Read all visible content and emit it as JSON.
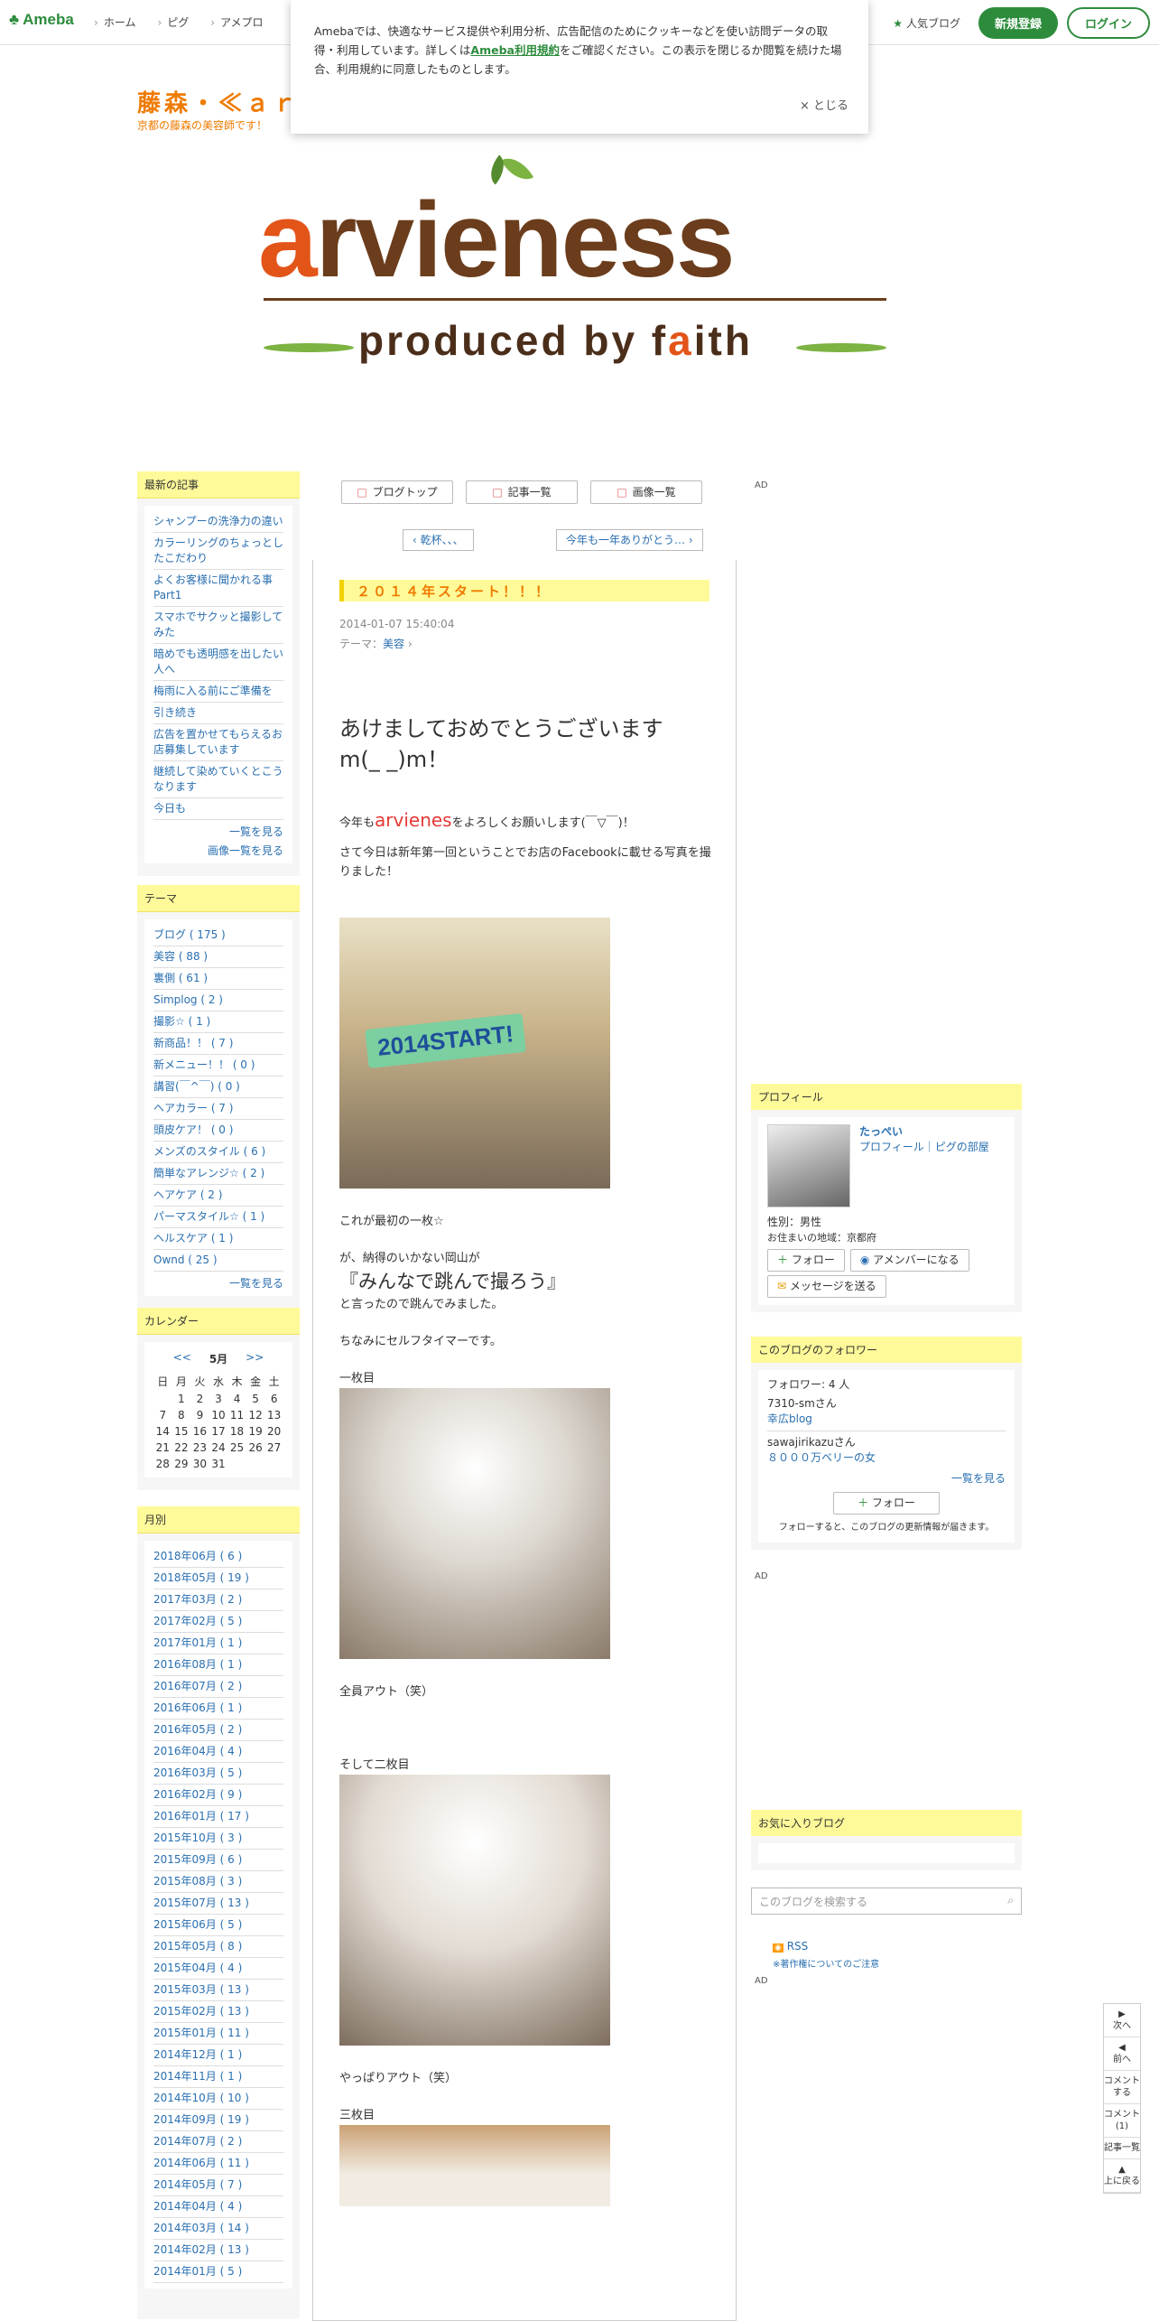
{
  "header": {
    "logo": "Ameba",
    "nav": [
      "ホーム",
      "ピグ",
      "アメプロ"
    ],
    "popular": "人気ブログ",
    "register": "新規登録",
    "login": "ログイン"
  },
  "cookie": {
    "text_before": "Amebaでは、快適なサービス提供や利用分析、広告配信のためにクッキーなどを使い訪問データの取得・利用しています。詳しくは",
    "link": "Ameba利用規約",
    "text_after": "をご確認ください。この表示を閉じるか閲覧を続けた場合、利用規約に同意したものとします。",
    "close": "× とじる"
  },
  "blog": {
    "title": "藤森・≪ａｒｖ",
    "subtitle": "京都の藤森の美容師です！"
  },
  "banner": {
    "word_orange": "a",
    "word_brown": "rvieness",
    "tag1": "produced by f",
    "tag2": "a",
    "tag3": "ith"
  },
  "recent": {
    "heading": "最新の記事",
    "items": [
      "シャンプーの洗浄力の違い",
      "カラーリングのちょっとしたこだわり",
      "よくお客様に聞かれる事 Part1",
      "スマホでサクッと撮影してみた",
      "暗めでも透明感を出したい人へ",
      "梅雨に入る前にご準備を",
      "引き続き",
      "広告を置かせてもらえるお店募集しています",
      "継続して染めていくとこうなります",
      "今日も"
    ],
    "more": "一覧を見る",
    "images": "画像一覧を見る"
  },
  "themes": {
    "heading": "テーマ",
    "items": [
      "ブログ ( 175 )",
      "美容 ( 88 )",
      "裏側 ( 61 )",
      "Simplog ( 2 )",
      "撮影☆ ( 1 )",
      "新商品！！ ( 7 )",
      "新メニュー！！ ( 0 )",
      "講習(￣^￣) ( 0 )",
      "ヘアカラー ( 7 )",
      "頭皮ケア！ ( 0 )",
      "メンズのスタイル ( 6 )",
      "簡単なアレンジ☆ ( 2 )",
      "ヘアケア ( 2 )",
      "パーマスタイル☆ ( 1 )",
      "ヘルスケア ( 1 )",
      "Ownd ( 25 )"
    ],
    "more": "一覧を見る"
  },
  "calendar": {
    "heading": "カレンダー",
    "prev": "<<",
    "month": "5月",
    "next": ">>",
    "days": [
      "日",
      "月",
      "火",
      "水",
      "木",
      "金",
      "土"
    ],
    "weeks": [
      [
        "",
        "1",
        "2",
        "3",
        "4",
        "5",
        "6"
      ],
      [
        "7",
        "8",
        "9",
        "10",
        "11",
        "12",
        "13"
      ],
      [
        "14",
        "15",
        "16",
        "17",
        "18",
        "19",
        "20"
      ],
      [
        "21",
        "22",
        "23",
        "24",
        "25",
        "26",
        "27"
      ],
      [
        "28",
        "29",
        "30",
        "31",
        "",
        "",
        ""
      ]
    ]
  },
  "archive": {
    "heading": "月別",
    "items": [
      "2018年06月 ( 6 )",
      "2018年05月 ( 19 )",
      "2017年03月 ( 2 )",
      "2017年02月 ( 5 )",
      "2017年01月 ( 1 )",
      "2016年08月 ( 1 )",
      "2016年07月 ( 2 )",
      "2016年06月 ( 1 )",
      "2016年05月 ( 2 )",
      "2016年04月 ( 4 )",
      "2016年03月 ( 5 )",
      "2016年02月 ( 9 )",
      "2016年01月 ( 17 )",
      "2015年10月 ( 3 )",
      "2015年09月 ( 6 )",
      "2015年08月 ( 3 )",
      "2015年07月 ( 13 )",
      "2015年06月 ( 5 )",
      "2015年05月 ( 8 )",
      "2015年04月 ( 4 )",
      "2015年03月 ( 13 )",
      "2015年02月 ( 13 )",
      "2015年01月 ( 11 )",
      "2014年12月 ( 1 )",
      "2014年11月 ( 1 )",
      "2014年10月 ( 10 )",
      "2014年09月 ( 19 )",
      "2014年07月 ( 2 )",
      "2014年06月 ( 11 )",
      "2014年05月 ( 7 )",
      "2014年04月 ( 4 )",
      "2014年03月 ( 14 )",
      "2014年02月 ( 13 )",
      "2014年01月 ( 5 )"
    ]
  },
  "toolbar": {
    "blogtop": "ブログトップ",
    "list": "記事一覧",
    "images": "画像一覧"
  },
  "pager": {
    "prev": "乾杯、、、",
    "next": "今年も一年ありがとう…"
  },
  "entry": {
    "title": "２０１４年スタート！！！",
    "date": "2014-01-07 15:40:04",
    "theme_label": "テーマ：",
    "theme": "美容",
    "p1": "あけましておめでとうございます",
    "p1b": "m(_ _)m！",
    "p2a": "今年も",
    "p2red": "arvienes",
    "p2b": "をよろしくお願いします(￣▽￣)！",
    "p3": "さて今日は新年第一回ということでお店のFacebookに載せる写真を撮りました！",
    "p4": "これが最初の一枚☆",
    "p5": "が、納得のいかない岡山が",
    "p6": "『みんなで跳んで撮ろう』",
    "p7": "と言ったので跳んでみました。",
    "p8": "ちなみにセルフタイマーです。",
    "p9": "一枚目",
    "p10": "全員アウト（笑）",
    "p11": "そして二枚目",
    "p12": "やっぱりアウト（笑）",
    "p13": "三枚目"
  },
  "profile": {
    "heading": "プロフィール",
    "name": "たっぺい",
    "links": "プロフィール｜ピグの部屋",
    "sex": "性別：男性",
    "area": "お住まいの地域：京都府",
    "follow": "フォロー",
    "member": "アメンバーになる",
    "message": "メッセージを送る"
  },
  "followers": {
    "heading": "このブログのフォロワー",
    "count": "フォロワー: 4 人",
    "f1": "7310-smさん",
    "f1b": "幸広blog",
    "f2": "sawajirikazuさん",
    "f2b": "８０００万ベリーの女",
    "more": "一覧を見る",
    "follow": "フォロー",
    "note": "フォローすると、このブログの更新情報が届きます。"
  },
  "fav": {
    "heading": "お気に入りブログ"
  },
  "search": {
    "placeholder": "このブログを検索する"
  },
  "rss": {
    "label": "RSS",
    "note": "※著作権についてのご注意"
  },
  "ad": "AD",
  "floatnav": [
    "次へ",
    "前へ",
    "コメントする",
    "コメント(1)",
    "記事一覧",
    "上に戻る"
  ]
}
